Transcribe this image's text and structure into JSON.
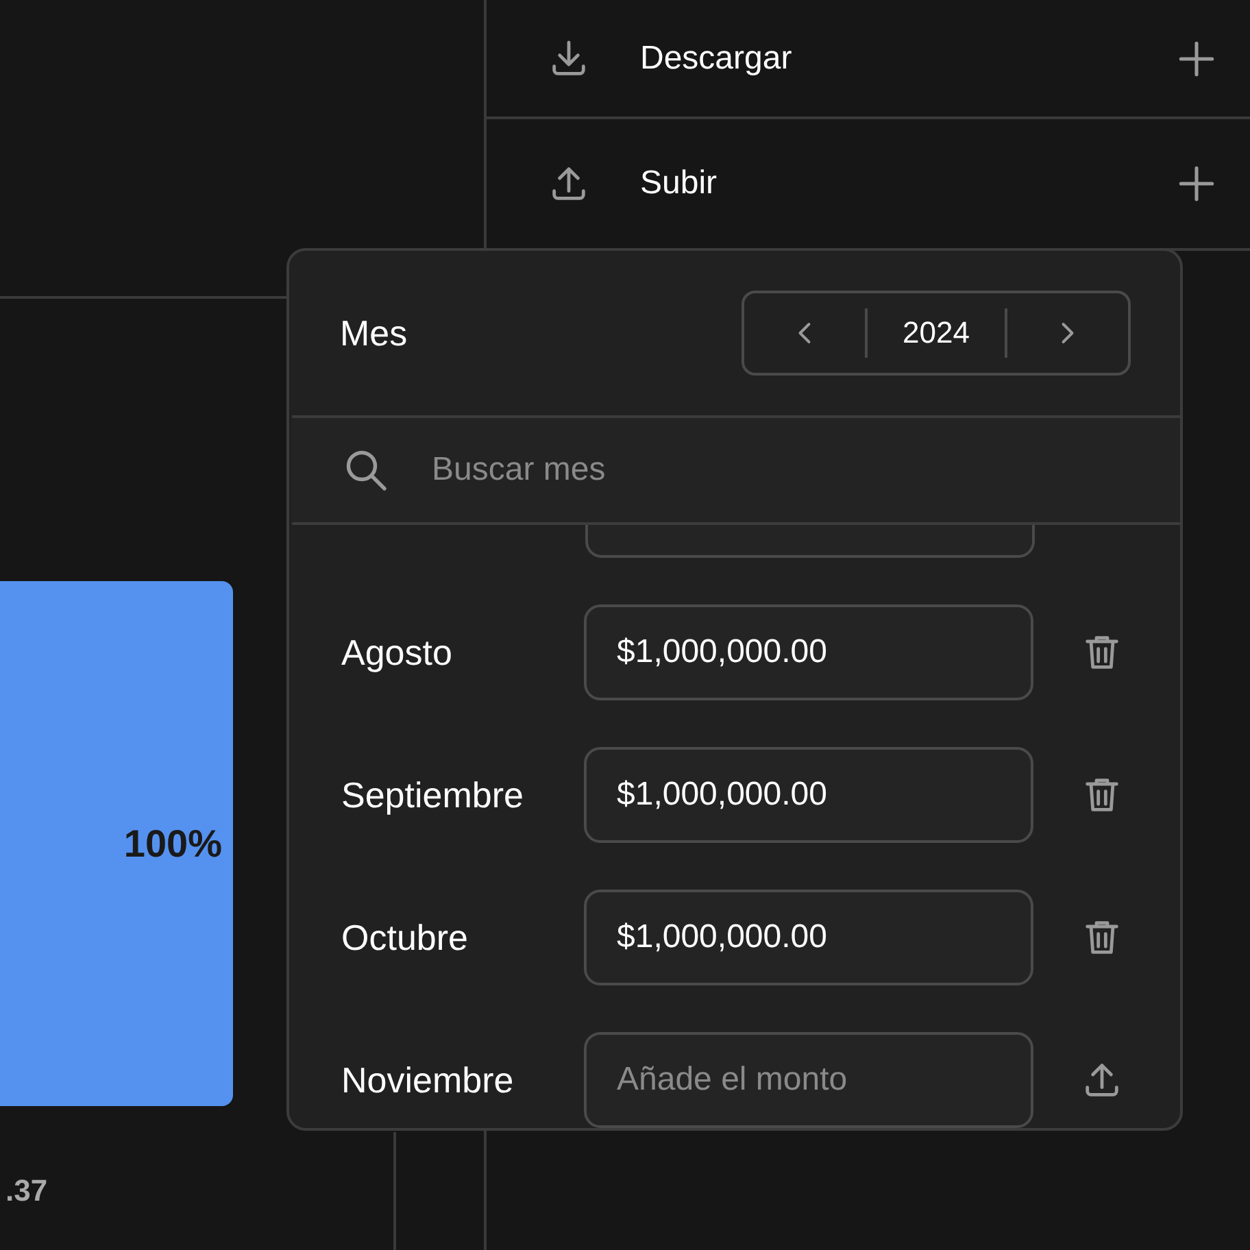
{
  "actions": [
    {
      "label": "Descargar",
      "kind": "download"
    },
    {
      "label": "Subir",
      "kind": "upload"
    }
  ],
  "bar": {
    "label": "100%"
  },
  "footer_value": ".37",
  "month_picker": {
    "title": "Mes",
    "year": "2024",
    "search": {
      "placeholder": "Buscar mes"
    },
    "rows": [
      {
        "month": "Agosto",
        "value": "$1,000,000.00",
        "kind": "filled"
      },
      {
        "month": "Septiembre",
        "value": "$1,000,000.00",
        "kind": "filled"
      },
      {
        "month": "Octubre",
        "value": "$1,000,000.00",
        "kind": "filled"
      },
      {
        "month": "Noviembre",
        "placeholder": "Añade el monto",
        "kind": "empty"
      }
    ]
  }
}
